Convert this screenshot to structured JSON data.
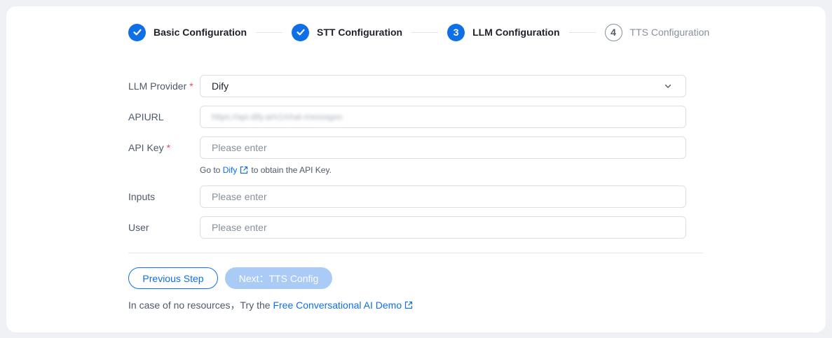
{
  "steps": [
    {
      "number": "1",
      "label": "Basic Configuration",
      "status": "done"
    },
    {
      "number": "2",
      "label": "STT Configuration",
      "status": "done"
    },
    {
      "number": "3",
      "label": "LLM Configuration",
      "status": "active"
    },
    {
      "number": "4",
      "label": "TTS Configuration",
      "status": "pending"
    }
  ],
  "form": {
    "provider": {
      "label": "LLM Provider",
      "required_mark": "*",
      "value": "Dify",
      "icon": "chevron-down-icon"
    },
    "apiurl": {
      "label": "APIURL",
      "value": "https://api.dify.ai/v1/chat-messages"
    },
    "apikey": {
      "label": "API Key",
      "required_mark": "*",
      "placeholder": "Please enter"
    },
    "apikey_hint": {
      "prefix": "Go to",
      "link": "Dify",
      "suffix": "to obtain the API Key."
    },
    "inputs": {
      "label": "Inputs",
      "placeholder": "Please enter"
    },
    "user": {
      "label": "User",
      "placeholder": "Please enter"
    }
  },
  "buttons": {
    "previous": "Previous Step",
    "next": "Next：TTS Config"
  },
  "footer": {
    "text": "In case of no resources，Try the",
    "link": "Free Conversational AI Demo"
  },
  "colors": {
    "primary": "#0f6fe6",
    "disabled_primary": "#a9cbf5",
    "required": "#e34d59"
  }
}
